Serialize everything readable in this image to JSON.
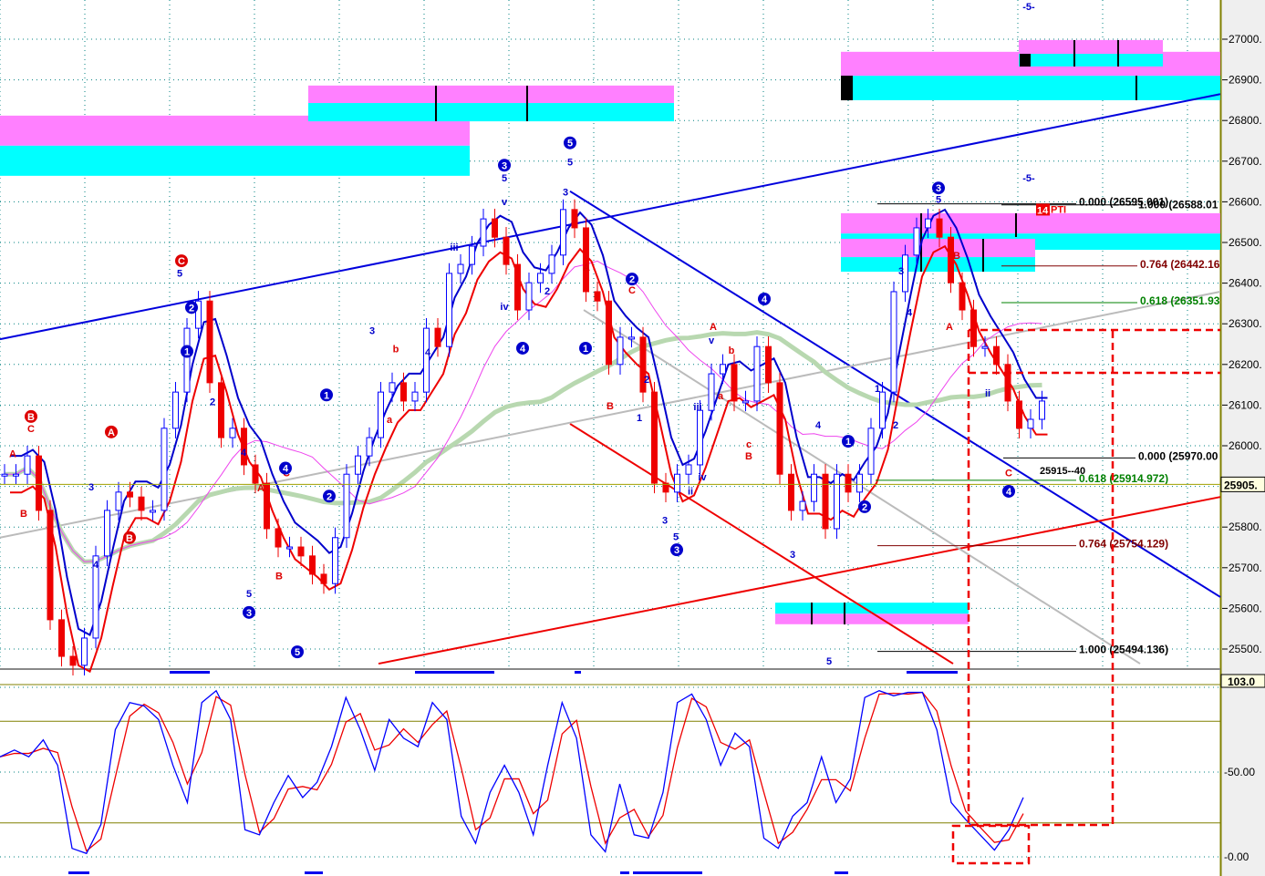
{
  "chart_data": {
    "type": "candlestick",
    "title": "",
    "price_axis": {
      "ylim": [
        25440,
        27050
      ],
      "ticks": [
        27000,
        26900,
        26800,
        26700,
        26600,
        26500,
        26400,
        26300,
        26200,
        26100,
        26000,
        25900,
        25800,
        25700,
        25600,
        25500
      ],
      "tick_labels": [
        "27000.",
        "26900.",
        "26800.",
        "26700.",
        "26600.",
        "26500.",
        "26400.",
        "26300.",
        "26200.",
        "26100.",
        "26000.",
        "25900.",
        "25800.",
        "25700.",
        "25600.",
        "25500."
      ]
    },
    "current_price_label": "25905.",
    "current_price": 25905,
    "close": [
      25930,
      25930,
      25975,
      25841,
      25572,
      25482,
      25460,
      25527,
      25729,
      25841,
      25886,
      25874,
      25841,
      25841,
      26043,
      26132,
      26289,
      26356,
      26155,
      26020,
      26043,
      25953,
      25908,
      25796,
      25751,
      25751,
      25729,
      25684,
      25661,
      25774,
      25930,
      25975,
      26020,
      26132,
      26155,
      26110,
      26132,
      26289,
      26244,
      26424,
      26446,
      26491,
      26558,
      26513,
      26446,
      26334,
      26401,
      26424,
      26469,
      26581,
      26536,
      26379,
      26356,
      26200,
      26267,
      26267,
      26132,
      25908,
      25886,
      25930,
      25953,
      26087,
      26177,
      26200,
      26110,
      26110,
      26244,
      26155,
      25930,
      25841,
      25863,
      25930,
      25796,
      25930,
      25886,
      25930,
      26043,
      26132,
      26379,
      26469,
      26536,
      26558,
      26513,
      26401,
      26334,
      26244,
      26244,
      26200,
      26110,
      26043,
      26065,
      26110
    ],
    "stoch_axis": {
      "ylim": [
        -10,
        111
      ],
      "ticks": [
        100,
        50,
        0
      ],
      "tick_labels": [
        "100.00",
        "50.00",
        "0.00"
      ],
      "levels": [
        100,
        80,
        20
      ],
      "current_label": "103.0"
    },
    "stoch_k": [
      59,
      63,
      59,
      69,
      54,
      5,
      2,
      19,
      75,
      91,
      89,
      81,
      54,
      32,
      91,
      98,
      81,
      16,
      13,
      32,
      48,
      35,
      44,
      65,
      94,
      75,
      51,
      81,
      70,
      65,
      91,
      81,
      24,
      8,
      38,
      54,
      38,
      13,
      54,
      91,
      70,
      13,
      3,
      43,
      13,
      11,
      38,
      91,
      96,
      81,
      54,
      73,
      65,
      11,
      5,
      24,
      32,
      59,
      32,
      46,
      94,
      98,
      95,
      97,
      97,
      75,
      32,
      22,
      13,
      4,
      16,
      35
    ],
    "fib_levels": [
      {
        "label": "0.000 (26595.001)",
        "price": 26595.001,
        "color": "#000000"
      },
      {
        "label": "1.000 (26588.01",
        "price": 26588.01,
        "color": "#000000"
      },
      {
        "label": "0.764 (26442.16",
        "price": 26442.16,
        "color": "#800000"
      },
      {
        "label": "0.618 (26351.93",
        "price": 26351.93,
        "color": "#008000"
      },
      {
        "label": "0.000 (25970.00",
        "price": 25970.0,
        "color": "#000000"
      },
      {
        "label": "0.618 (25914.972)",
        "price": 25914.972,
        "color": "#008000"
      },
      {
        "label": "0.764 (25754.129)",
        "price": 25754.129,
        "color": "#800000"
      },
      {
        "label": "1.000 (25494.136)",
        "price": 25494.136,
        "color": "#000000"
      }
    ],
    "zones": [
      {
        "x0": 0,
        "x1": 51.5,
        "pink": [
          26812,
          26738
        ],
        "cyan": [
          26738,
          26664
        ]
      },
      {
        "x0": 33.8,
        "x1": 73.9,
        "pink": [
          26886,
          26843
        ],
        "cyan": [
          26843,
          26798
        ]
      },
      {
        "x0": 92.2,
        "x1": 133.8,
        "pink": [
          26969,
          26910
        ],
        "cyan": [
          26910,
          26850
        ]
      },
      {
        "x0": 111.7,
        "x1": 127.5,
        "pink": [
          26998,
          26964
        ],
        "cyan": [
          26964,
          26933
        ]
      },
      {
        "x0": 92.2,
        "x1": 133.8,
        "pink": [
          26572,
          26522
        ],
        "cyan": [
          26522,
          26482
        ]
      },
      {
        "x0": 92.2,
        "x1": 113.5,
        "pink": [
          26509,
          26464
        ],
        "cyan": [
          26464,
          26428
        ]
      },
      {
        "x0": 85,
        "x1": 106.2,
        "pink": [
          25587,
          25561
        ],
        "cyan": [
          25614,
          25587
        ]
      }
    ],
    "trendlines": [
      {
        "from": [
          0,
          26262
        ],
        "to": [
          133.8,
          26865
        ],
        "color": "#0000dd"
      },
      {
        "from": [
          62.5,
          26626
        ],
        "to": [
          133.8,
          25628
        ],
        "color": "#0000dd"
      },
      {
        "from": [
          41.5,
          25464
        ],
        "to": [
          133.8,
          25874
        ],
        "color": "#ee0000"
      },
      {
        "from": [
          62.5,
          26054
        ],
        "to": [
          104.5,
          25464
        ],
        "color": "#ee0000"
      },
      {
        "from": [
          0,
          25774
        ],
        "to": [
          133.8,
          26379
        ],
        "color": "#bbbbbb"
      },
      {
        "from": [
          64,
          26334
        ],
        "to": [
          125,
          25464
        ],
        "color": "#bbbbbb"
      }
    ],
    "circled_labels": [
      {
        "t": "3",
        "x": 55.3,
        "p": 26690,
        "c": "#0000cc"
      },
      {
        "t": "5",
        "x": 62.5,
        "p": 26745,
        "c": "#0000cc"
      },
      {
        "t": "2",
        "x": 21,
        "p": 26340,
        "c": "#0000cc"
      },
      {
        "t": "1",
        "x": 20.5,
        "p": 26232,
        "c": "#0000cc"
      },
      {
        "t": "1",
        "x": 35.8,
        "p": 26125,
        "c": "#0000cc"
      },
      {
        "t": "2",
        "x": 36.1,
        "p": 25876,
        "c": "#0000cc"
      },
      {
        "t": "4",
        "x": 31.3,
        "p": 25945,
        "c": "#0000cc"
      },
      {
        "t": "3",
        "x": 27.3,
        "p": 25590,
        "c": "#0000cc"
      },
      {
        "t": "5",
        "x": 32.6,
        "p": 25493,
        "c": "#0000cc"
      },
      {
        "t": "4",
        "x": 57.3,
        "p": 26240,
        "c": "#0000cc"
      },
      {
        "t": "1",
        "x": 64.2,
        "p": 26240,
        "c": "#0000cc"
      },
      {
        "t": "2",
        "x": 69.3,
        "p": 26410,
        "c": "#0000cc"
      },
      {
        "t": "4",
        "x": 83.8,
        "p": 26361,
        "c": "#0000cc"
      },
      {
        "t": "3",
        "x": 74.2,
        "p": 25744,
        "c": "#0000cc"
      },
      {
        "t": "1",
        "x": 93,
        "p": 26011,
        "c": "#0000cc"
      },
      {
        "t": "2",
        "x": 94.8,
        "p": 25850,
        "c": "#0000cc"
      },
      {
        "t": "3",
        "x": 102.9,
        "p": 26634,
        "c": "#0000cc"
      },
      {
        "t": "4",
        "x": 110.6,
        "p": 25888,
        "c": "#0000cc"
      },
      {
        "t": "C",
        "x": 19.9,
        "p": 26455,
        "c": "#dd0000"
      },
      {
        "t": "A",
        "x": 12.2,
        "p": 26034,
        "c": "#dd0000"
      },
      {
        "t": "B",
        "x": 3.4,
        "p": 26072,
        "c": "#dd0000"
      },
      {
        "t": "B",
        "x": 14.2,
        "p": 25774,
        "c": "#dd0000"
      }
    ],
    "wave_labels": [
      {
        "t": "-5-",
        "x": 112.8,
        "p": 27072,
        "c": "#0000cc"
      },
      {
        "t": "-5-",
        "x": 112.8,
        "p": 26650,
        "c": "#0000cc"
      },
      {
        "t": "5",
        "x": 55.3,
        "p": 26650,
        "c": "#0000cc"
      },
      {
        "t": "v",
        "x": 55.3,
        "p": 26592,
        "c": "#0000cc"
      },
      {
        "t": "5",
        "x": 62.5,
        "p": 26690,
        "c": "#0000cc"
      },
      {
        "t": "3",
        "x": 62,
        "p": 26615,
        "c": "#0000cc"
      },
      {
        "t": "5",
        "x": 19.7,
        "p": 26416,
        "c": "#0000cc"
      },
      {
        "t": "5",
        "x": 102.9,
        "p": 26597,
        "c": "#0000cc"
      },
      {
        "t": "iii",
        "x": 49.8,
        "p": 26480,
        "c": "#0000cc"
      },
      {
        "t": "iv",
        "x": 55.3,
        "p": 26334,
        "c": "#0000cc"
      },
      {
        "t": "iii",
        "x": 76.5,
        "p": 26087,
        "c": "#0000cc"
      },
      {
        "t": "iv",
        "x": 77,
        "p": 25915,
        "c": "#0000cc"
      },
      {
        "t": "ii",
        "x": 75.7,
        "p": 25880,
        "c": "#0000cc"
      },
      {
        "t": "3",
        "x": 72.9,
        "p": 25808,
        "c": "#0000cc"
      },
      {
        "t": "5",
        "x": 74.1,
        "p": 25768,
        "c": "#0000cc"
      },
      {
        "t": "3",
        "x": 86.9,
        "p": 25724,
        "c": "#0000cc"
      },
      {
        "t": "5",
        "x": 90.9,
        "p": 25462,
        "c": "#0000cc"
      },
      {
        "t": "4",
        "x": 89.7,
        "p": 26043,
        "c": "#0000cc"
      },
      {
        "t": "3",
        "x": 98.8,
        "p": 26422,
        "c": "#0000cc"
      },
      {
        "t": "4",
        "x": 99.7,
        "p": 26320,
        "c": "#0000cc"
      },
      {
        "t": "2",
        "x": 98.2,
        "p": 26043,
        "c": "#0000cc"
      },
      {
        "t": "1",
        "x": 96.2,
        "p": 26132,
        "c": "#0000cc"
      },
      {
        "t": "ii",
        "x": 108.3,
        "p": 26121,
        "c": "#0000cc"
      },
      {
        "t": "5",
        "x": 27.3,
        "p": 25628,
        "c": "#0000cc"
      },
      {
        "t": "3",
        "x": 40.8,
        "p": 26275,
        "c": "#0000cc"
      },
      {
        "t": "4",
        "x": 10.5,
        "p": 25700,
        "c": "#0000cc"
      },
      {
        "t": "3",
        "x": 10,
        "p": 25890,
        "c": "#0000cc"
      },
      {
        "t": "4",
        "x": 26.7,
        "p": 25975,
        "c": "#0000cc"
      },
      {
        "t": "2",
        "x": 23.3,
        "p": 26100,
        "c": "#0000cc"
      },
      {
        "t": "v",
        "x": 78,
        "p": 26251,
        "c": "#0000cc"
      },
      {
        "t": "2",
        "x": 70.9,
        "p": 26155,
        "c": "#0000cc"
      },
      {
        "t": "1",
        "x": 70.1,
        "p": 26060,
        "c": "#0000cc"
      },
      {
        "t": "4",
        "x": 46.9,
        "p": 26222,
        "c": "#0000cc"
      },
      {
        "t": "2",
        "x": 60,
        "p": 26372,
        "c": "#0000cc"
      },
      {
        "t": "A",
        "x": 1.4,
        "p": 25972,
        "c": "#dd0000"
      },
      {
        "t": "B",
        "x": 2.6,
        "p": 25825,
        "c": "#dd0000"
      },
      {
        "t": "C",
        "x": 3.4,
        "p": 26034,
        "c": "#dd0000"
      },
      {
        "t": "C",
        "x": 31.4,
        "p": 25925,
        "c": "#dd0000"
      },
      {
        "t": "A",
        "x": 28.6,
        "p": 25888,
        "c": "#dd0000"
      },
      {
        "t": "B",
        "x": 30.6,
        "p": 25672,
        "c": "#dd0000"
      },
      {
        "t": "A",
        "x": 64.3,
        "p": 26430,
        "c": "#dd0000"
      },
      {
        "t": "B",
        "x": 66.9,
        "p": 26090,
        "c": "#dd0000"
      },
      {
        "t": "C",
        "x": 69.3,
        "p": 26375,
        "c": "#dd0000"
      },
      {
        "t": "A",
        "x": 78.2,
        "p": 26285,
        "c": "#dd0000"
      },
      {
        "t": "c",
        "x": 82.1,
        "p": 25995,
        "c": "#dd0000"
      },
      {
        "t": "B",
        "x": 82.1,
        "p": 25966,
        "c": "#dd0000"
      },
      {
        "t": "a",
        "x": 79,
        "p": 26114,
        "c": "#dd0000"
      },
      {
        "t": "b",
        "x": 80.2,
        "p": 26226,
        "c": "#dd0000"
      },
      {
        "t": "A",
        "x": 104.1,
        "p": 26285,
        "c": "#dd0000"
      },
      {
        "t": "B",
        "x": 104.9,
        "p": 26460,
        "c": "#dd0000"
      },
      {
        "t": "C",
        "x": 110.6,
        "p": 25925,
        "c": "#dd0000"
      },
      {
        "t": "b",
        "x": 43.4,
        "p": 26230,
        "c": "#dd0000"
      },
      {
        "t": "a",
        "x": 42.7,
        "p": 26056,
        "c": "#dd0000"
      }
    ],
    "annotations": [
      {
        "t": "25915--40",
        "x": 114,
        "p": 25930,
        "c": "#000000"
      },
      {
        "t": "PTI",
        "x": 115.2,
        "p": 26573,
        "c": "#ee0000",
        "badge": "14"
      }
    ],
    "colors": {
      "up": "#0000ff",
      "down": "#ee0000",
      "ma_slow": "#b8d8b0",
      "ma_mid": "#ee44ee",
      "band_upper": "#0000cc",
      "band_lower": "#ee0000",
      "stoch_k": "#0000ff",
      "stoch_d": "#ee0000",
      "pink": "#ff80ff",
      "cyan": "#00ffff"
    }
  }
}
